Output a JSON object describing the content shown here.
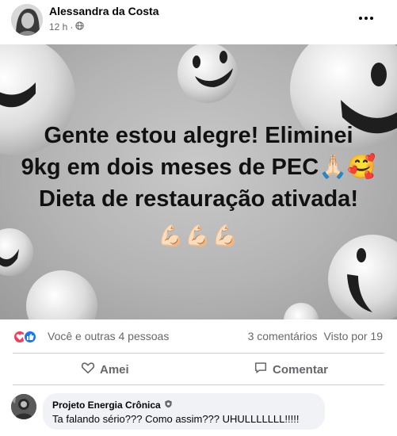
{
  "post": {
    "author": "Alessandra da Costa",
    "time": "12 h",
    "separator": "·",
    "privacy_icon": "globe-icon",
    "menu_icon": "more-icon"
  },
  "image": {
    "line1": "Gente estou alegre! Eliminei",
    "line2": "9kg em dois meses de PEC🙏🏻🥰",
    "line3": "Dieta de restauração ativada!",
    "muscles": "💪🏻💪🏻💪🏻"
  },
  "reactions": {
    "icons": [
      "heart-react-icon",
      "like-react-icon"
    ],
    "people": "Você e outras 4 pessoas",
    "comments": "3 comentários",
    "views": "Visto por 19"
  },
  "actions": {
    "love": "Amei",
    "comment": "Comentar"
  },
  "comment": {
    "author": "Projeto Energia Crônica",
    "badge_icon": "badge-icon",
    "text": "Ta falando sério??? Como assim??? UHULLLLLLL!!!!!"
  },
  "colors": {
    "secondary_text": "#65676b",
    "divider": "#ced0d4",
    "bubble": "#f0f2f5",
    "heart": "#f33e58",
    "like": "#1877f2"
  }
}
